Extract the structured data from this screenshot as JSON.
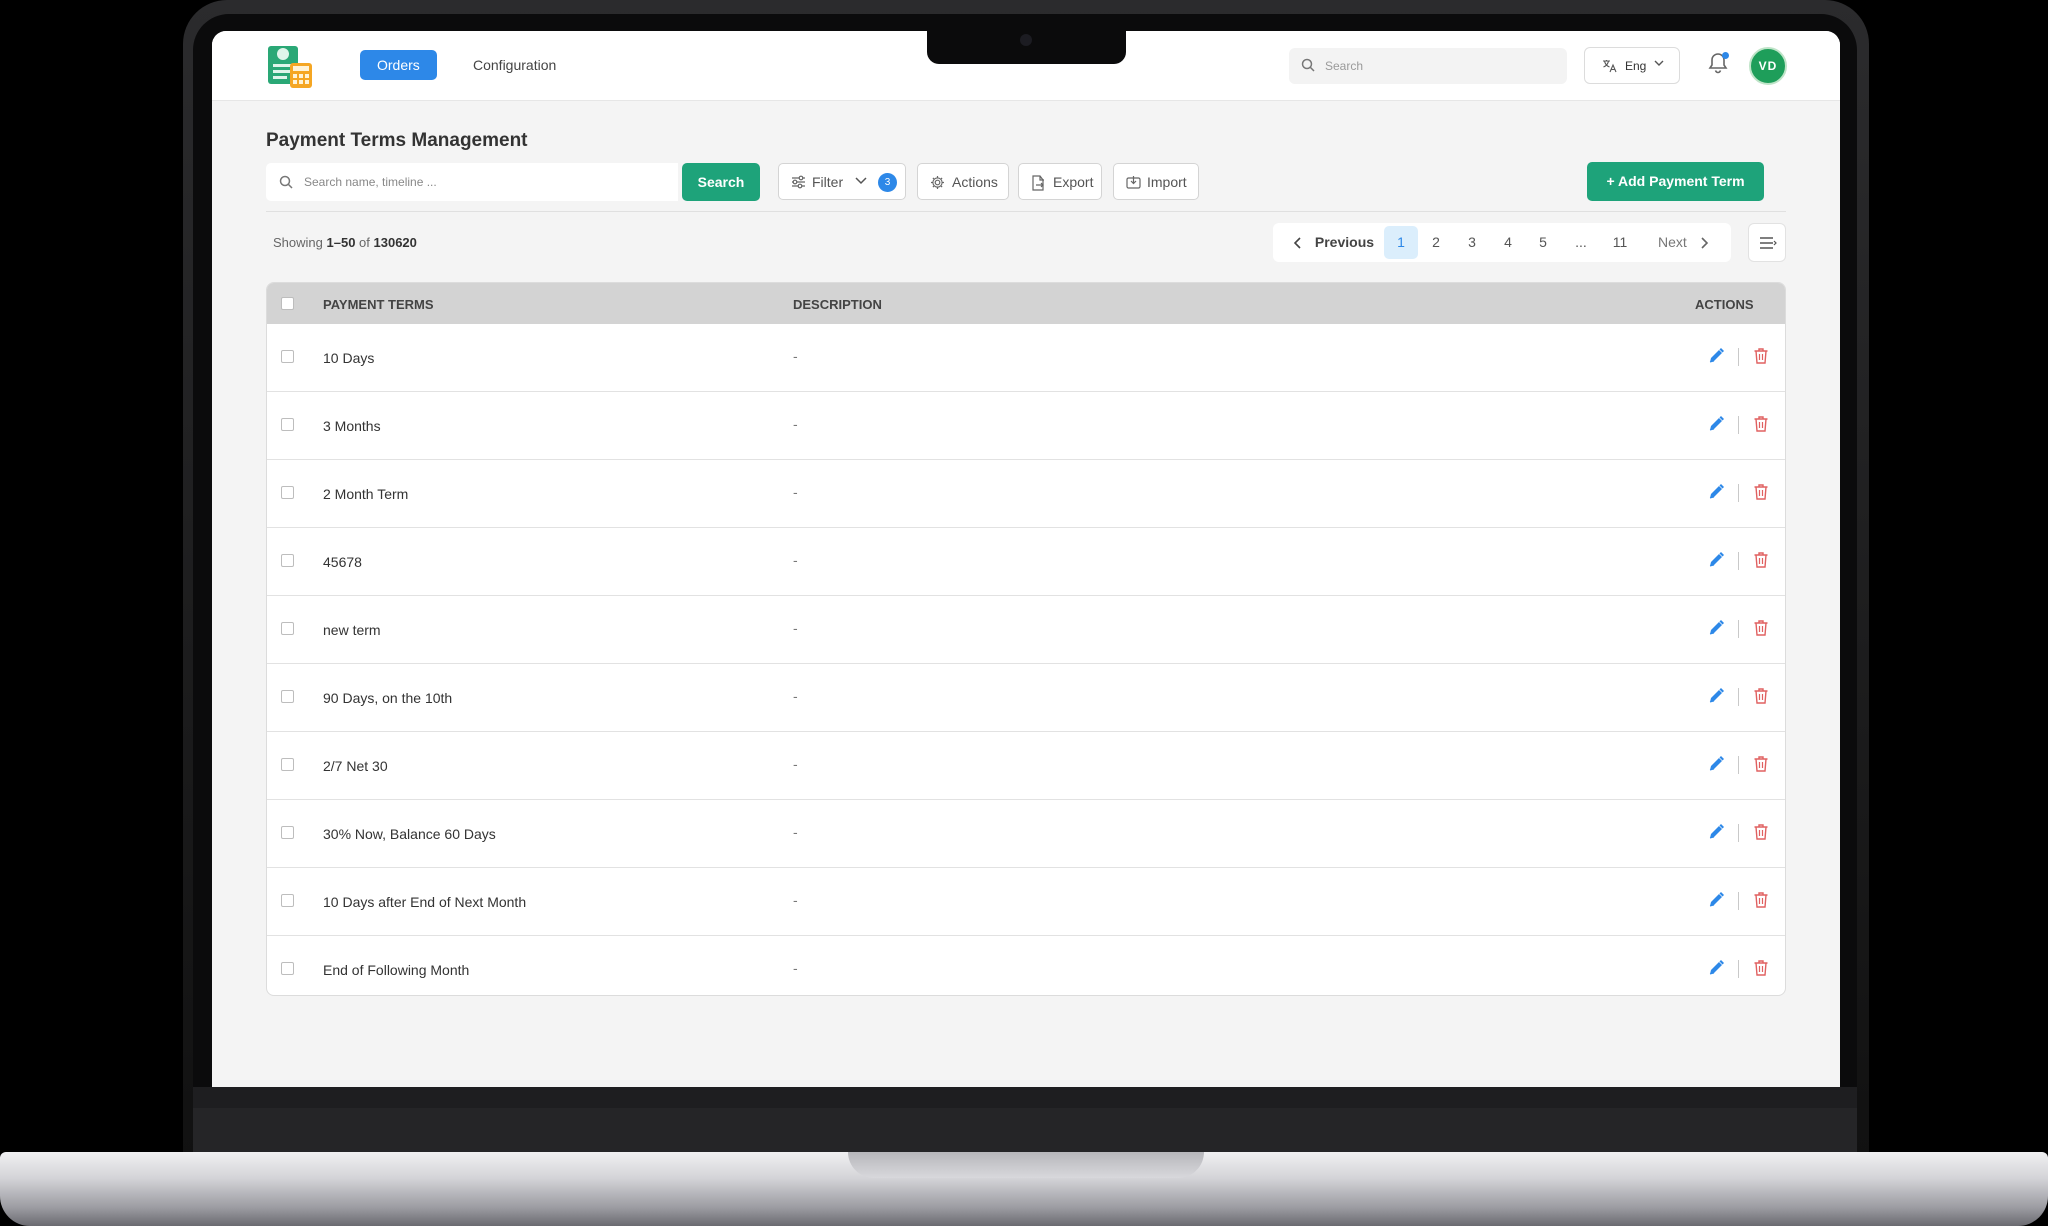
{
  "app": {
    "nav": {
      "orders": "Orders",
      "configuration": "Configuration"
    },
    "top_search_placeholder": "Search",
    "language": "Eng",
    "avatar_initials": "VD"
  },
  "page": {
    "title": "Payment Terms Management",
    "search_placeholder": "Search name, timeline ...",
    "search_button": "Search",
    "filter_label": "Filter",
    "filter_count": "3",
    "actions_label": "Actions",
    "export_label": "Export",
    "import_label": "Import",
    "add_button": "+ Add Payment Term",
    "showing_prefix": "Showing",
    "showing_range": "1–50",
    "showing_of": "of",
    "showing_total": "130620"
  },
  "pagination": {
    "previous": "Previous",
    "next": "Next",
    "pages": [
      "1",
      "2",
      "3",
      "4",
      "5",
      "...",
      "11"
    ],
    "current": "1"
  },
  "table": {
    "columns": {
      "terms": "PAYMENT TERMS",
      "description": "DESCRIPTION",
      "actions": "ACTIONS"
    },
    "rows": [
      {
        "term": "10 Days",
        "description": "-"
      },
      {
        "term": "3 Months",
        "description": "-"
      },
      {
        "term": "2 Month Term",
        "description": "-"
      },
      {
        "term": "45678",
        "description": "-"
      },
      {
        "term": "new term",
        "description": "-"
      },
      {
        "term": "90 Days, on the 10th",
        "description": "-"
      },
      {
        "term": "2/7 Net 30",
        "description": "-"
      },
      {
        "term": "30% Now, Balance 60 Days",
        "description": "-"
      },
      {
        "term": "10 Days after End of Next Month",
        "description": "-"
      },
      {
        "term": "End of Following Month",
        "description": "-"
      }
    ]
  },
  "colors": {
    "primary": "#2d88e8",
    "success": "#1ea37a",
    "danger": "#e06060",
    "header_bg": "#d3d3d3"
  },
  "icons": [
    "search-icon",
    "translate-icon",
    "chevron-down-icon",
    "bell-icon",
    "sliders-icon",
    "gear-icon",
    "export-icon",
    "import-icon",
    "chevron-left-icon",
    "chevron-right-icon",
    "list-icon",
    "edit-icon",
    "trash-icon"
  ]
}
